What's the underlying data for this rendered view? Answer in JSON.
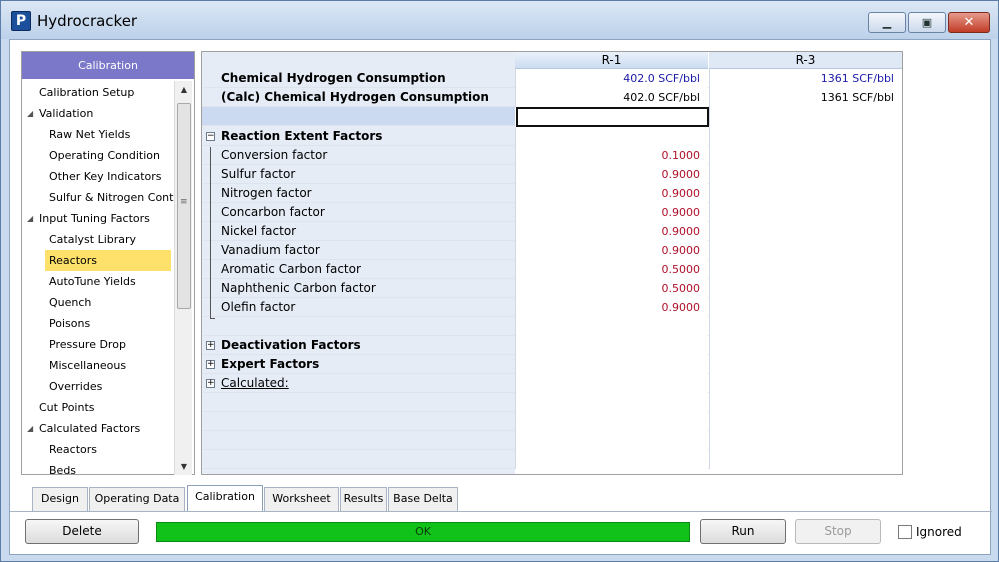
{
  "window": {
    "title": "Hydrocracker",
    "app_icon_letter": "P",
    "controls": {
      "minimize": "▁",
      "maximize": "▣",
      "close": "✕"
    }
  },
  "left_panel": {
    "header": "Calibration",
    "items": [
      {
        "label": "Calibration Setup",
        "level": 0
      },
      {
        "label": "Validation",
        "level": 0,
        "expander": "◢"
      },
      {
        "label": "Raw Net Yields",
        "level": 1
      },
      {
        "label": "Operating Condition",
        "level": 1
      },
      {
        "label": "Other Key Indicators",
        "level": 1
      },
      {
        "label": "Sulfur & Nitrogen Conte",
        "level": 1
      },
      {
        "label": "Input Tuning Factors",
        "level": 0,
        "expander": "◢"
      },
      {
        "label": "Catalyst Library",
        "level": 1
      },
      {
        "label": "Reactors",
        "level": 1,
        "selected": true
      },
      {
        "label": "AutoTune Yields",
        "level": 1
      },
      {
        "label": "Quench",
        "level": 1
      },
      {
        "label": "Poisons",
        "level": 1
      },
      {
        "label": "Pressure Drop",
        "level": 1
      },
      {
        "label": "Miscellaneous",
        "level": 1
      },
      {
        "label": "Overrides",
        "level": 1
      },
      {
        "label": "Cut Points",
        "level": 0
      },
      {
        "label": "Calculated Factors",
        "level": 0,
        "expander": "◢"
      },
      {
        "label": "Reactors",
        "level": 1
      },
      {
        "label": "Beds",
        "level": 1
      }
    ],
    "scroll_up": "▲",
    "scroll_down": "▼"
  },
  "grid": {
    "columns": [
      "R-1",
      "R-3"
    ],
    "rows": [
      {
        "label": "Chemical Hydrogen Consumption",
        "bold": true,
        "r1": "402.0 SCF/bbl",
        "r3": "1361 SCF/bbl",
        "color": "blue"
      },
      {
        "label": "(Calc) Chemical Hydrogen Consumption",
        "bold": true,
        "r1": "402.0 SCF/bbl",
        "r3": "1361 SCF/bbl",
        "color": "black"
      }
    ],
    "reaction_group": {
      "label": "Reaction Extent Factors",
      "toggle": "−",
      "factors": [
        {
          "label": "Conversion factor",
          "r1": "0.1000"
        },
        {
          "label": "Sulfur factor",
          "r1": "0.9000"
        },
        {
          "label": "Nitrogen factor",
          "r1": "0.9000"
        },
        {
          "label": "Concarbon factor",
          "r1": "0.9000"
        },
        {
          "label": "Nickel factor",
          "r1": "0.9000"
        },
        {
          "label": "Vanadium factor",
          "r1": "0.9000"
        },
        {
          "label": "Aromatic Carbon factor",
          "r1": "0.5000"
        },
        {
          "label": "Naphthenic Carbon factor",
          "r1": "0.5000"
        },
        {
          "label": "Olefin factor",
          "r1": "0.9000"
        }
      ]
    },
    "collapsed_groups": [
      {
        "label": "Deactivation Factors",
        "toggle": "+"
      },
      {
        "label": "Expert Factors",
        "toggle": "+"
      },
      {
        "label": "Calculated:",
        "toggle": "+"
      }
    ]
  },
  "tabs": [
    "Design",
    "Operating Data",
    "Calibration",
    "Worksheet",
    "Results",
    "Base Delta"
  ],
  "active_tab": "Calibration",
  "buttons": {
    "delete": "Delete",
    "run": "Run",
    "stop": "Stop"
  },
  "status": "OK",
  "ignored_label": "Ignored"
}
